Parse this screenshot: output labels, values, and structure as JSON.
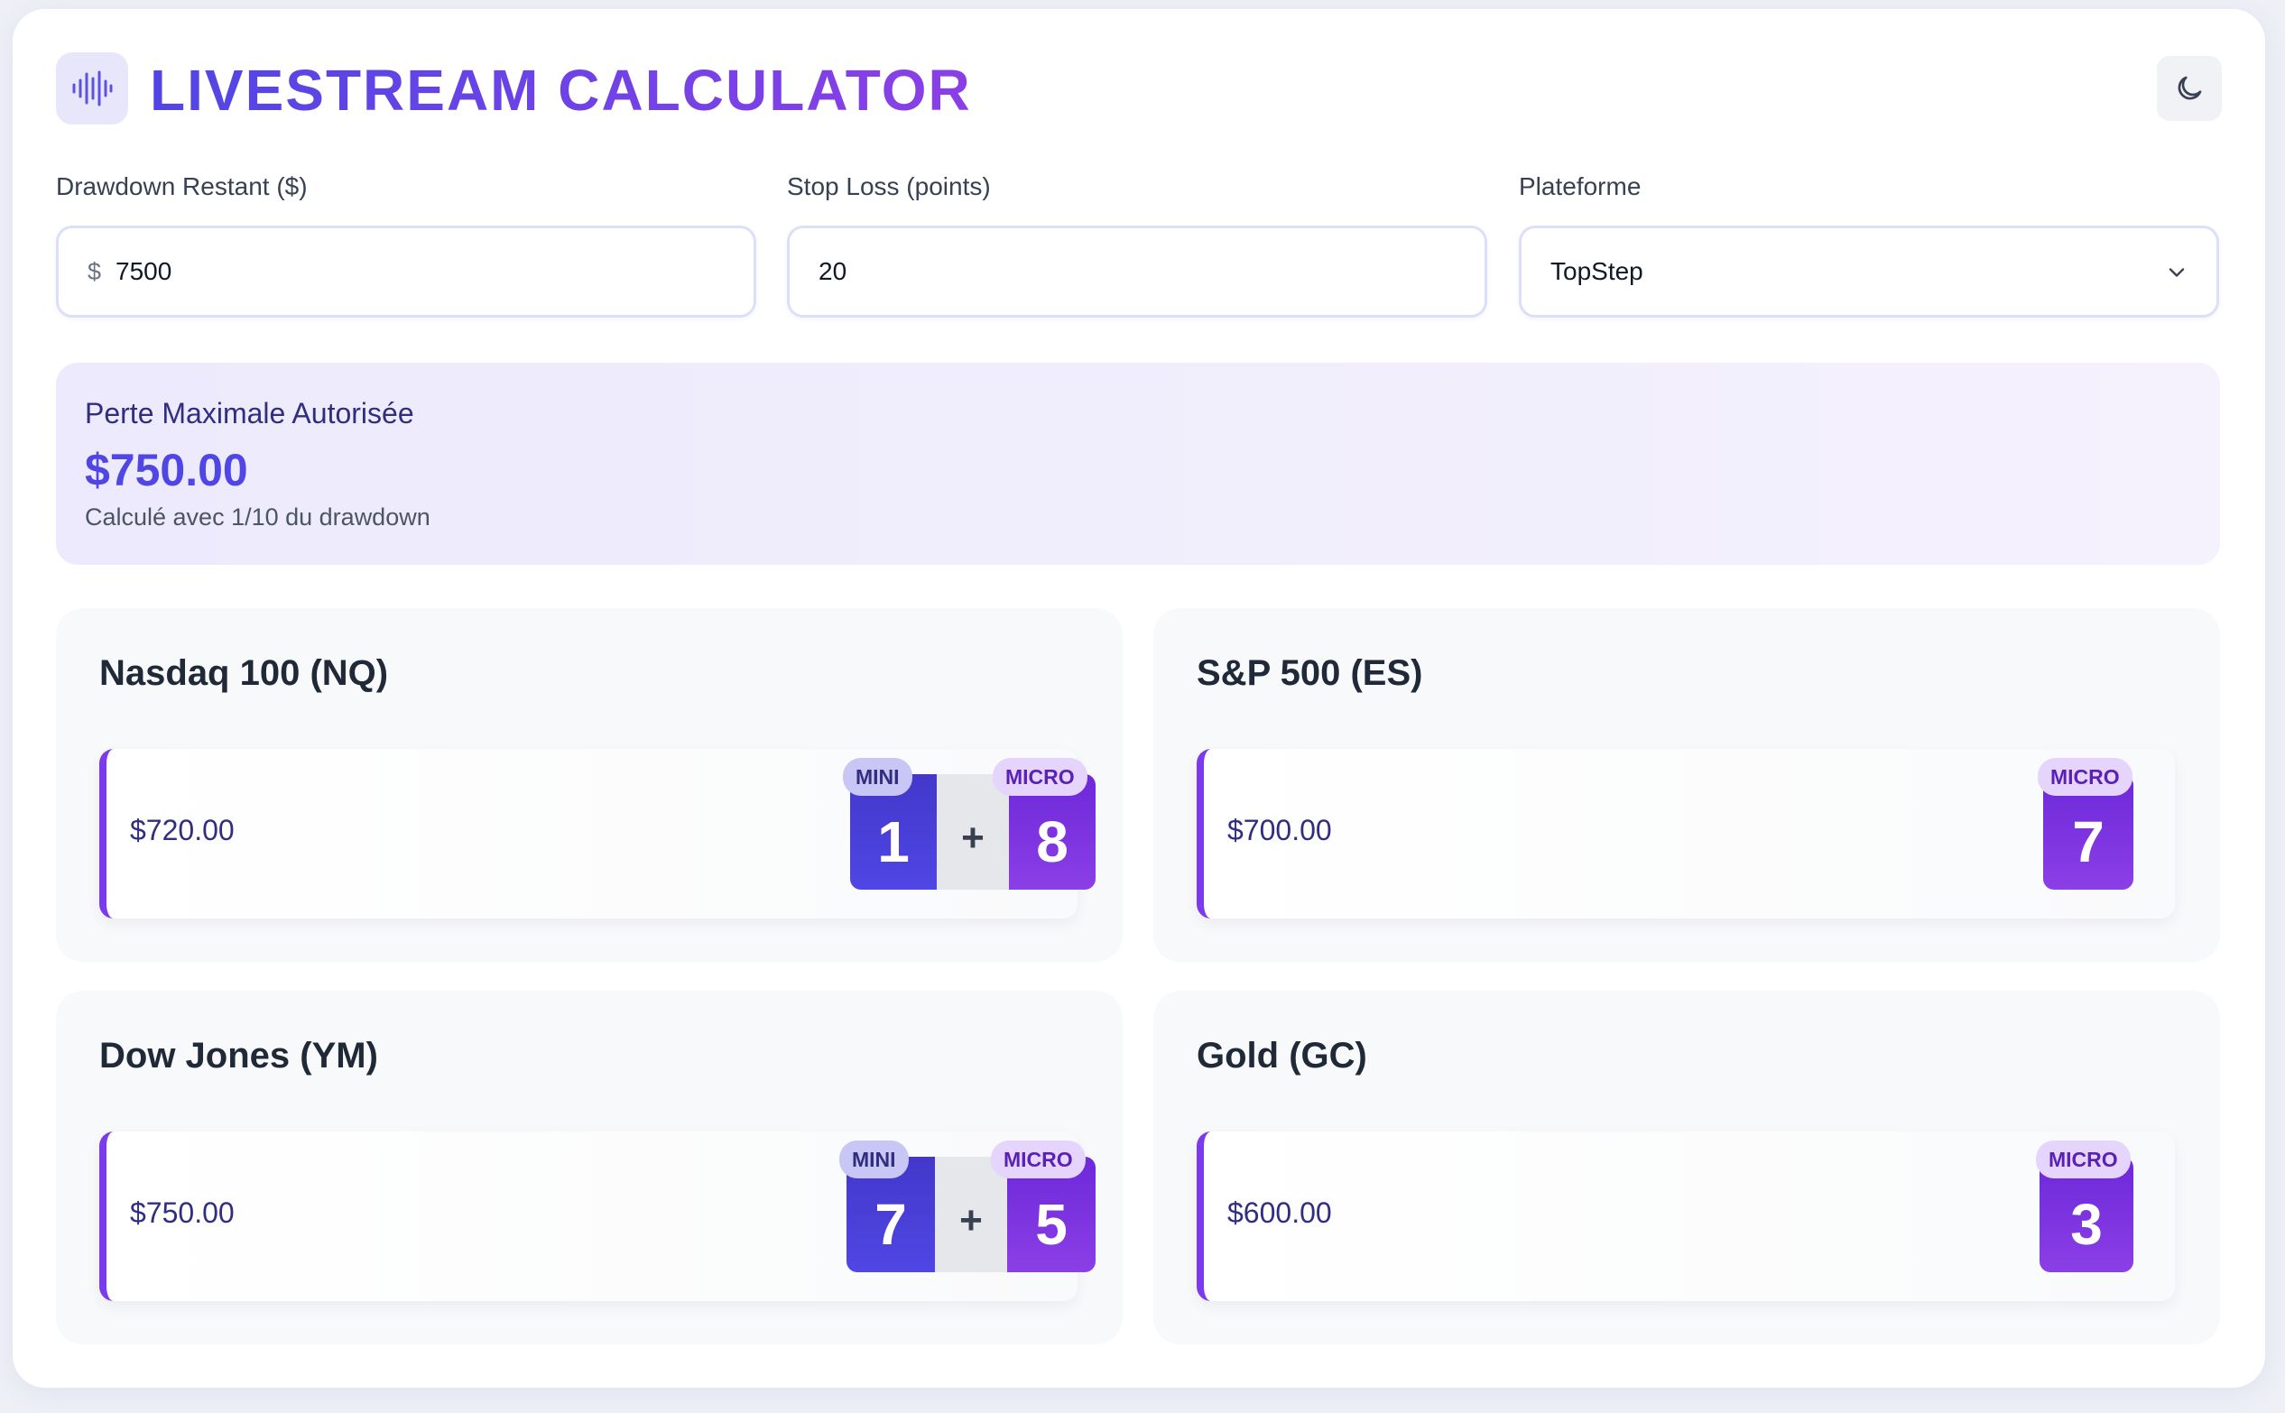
{
  "header": {
    "title": "LIVESTREAM CALCULATOR",
    "logo_icon": "audio-wave-icon",
    "theme_icon": "moon-icon"
  },
  "inputs": {
    "drawdown": {
      "label": "Drawdown Restant ($)",
      "prefix": "$",
      "value": "7500"
    },
    "stop_loss": {
      "label": "Stop Loss (points)",
      "value": "20"
    },
    "platform": {
      "label": "Plateforme",
      "value": "TopStep"
    }
  },
  "max_loss": {
    "label": "Perte Maximale Autorisée",
    "value": "$750.00",
    "note": "Calculé avec 1/10 du drawdown"
  },
  "instruments": [
    {
      "title": "Nasdaq 100 (NQ)",
      "amount": "$720.00",
      "mini_label": "MINI",
      "mini": "1",
      "micro_label": "MICRO",
      "micro": "8"
    },
    {
      "title": "S&P 500 (ES)",
      "amount": "$700.00",
      "micro_label": "MICRO",
      "micro": "7"
    },
    {
      "title": "Dow Jones (YM)",
      "amount": "$750.00",
      "mini_label": "MINI",
      "mini": "7",
      "micro_label": "MICRO",
      "micro": "5"
    },
    {
      "title": "Gold (GC)",
      "amount": "$600.00",
      "micro_label": "MICRO",
      "micro": "3"
    }
  ],
  "colors": {
    "accent_indigo": "#4f46e5",
    "accent_purple": "#8b3fe6",
    "background": "#eef0f6"
  }
}
